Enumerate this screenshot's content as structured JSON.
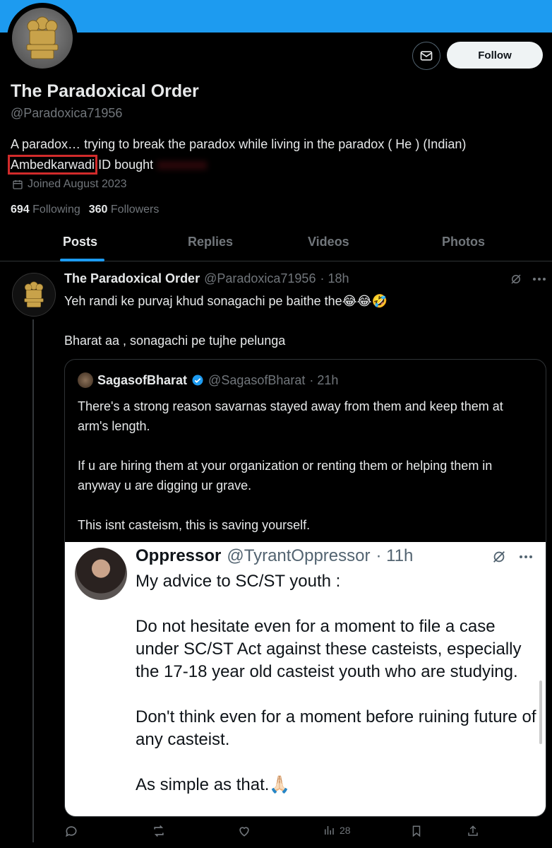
{
  "profile": {
    "name": "The Paradoxical Order",
    "handle": "@Paradoxica71956",
    "bio_line1": "A paradox… trying to break the paradox while living in the paradox ( He ) (Indian)",
    "bio_highlight": "Ambedkarwadi",
    "bio_rest": " ID bought",
    "joined": "Joined August 2023",
    "following_count": "694",
    "following_label": "Following",
    "followers_count": "360",
    "followers_label": "Followers",
    "follow_label": "Follow"
  },
  "tabs": [
    "Posts",
    "Replies",
    "Videos",
    "Photos"
  ],
  "post": {
    "name": "The Paradoxical Order",
    "handle": "@Paradoxica71956",
    "time": "· 18h",
    "text": "Yeh randi ke purvaj khud sonagachi pe baithe the😂😂🤣\n\nBharat aa , sonagachi pe tujhe pelunga"
  },
  "quote": {
    "name": "SagasofBharat",
    "handle": "@SagasofBharat",
    "time": "· 21h",
    "text": "There's a strong reason savarnas stayed away from them and keep them at arm's length.\n\nIf u are hiring them at your organization or renting them or helping them in anyway u are digging ur grave.\n\nThis isnt casteism, this is saving yourself."
  },
  "embedded_image": {
    "name": "Oppressor",
    "handle": "@TyrantOppressor",
    "time": "· 11h",
    "text": "My advice to SC/ST youth :\n\nDo not hesitate even for a moment to file a case under SC/ST Act against these casteists, especially the 17-18 year old casteist youth who are studying.\n\nDon't think even for a moment before ruining future of any casteist.\n\nAs simple as that.🙏🏻"
  },
  "actions": {
    "views": "28"
  },
  "colors": {
    "accent": "#1d9bf0",
    "highlight_box": "#d12b2b"
  }
}
